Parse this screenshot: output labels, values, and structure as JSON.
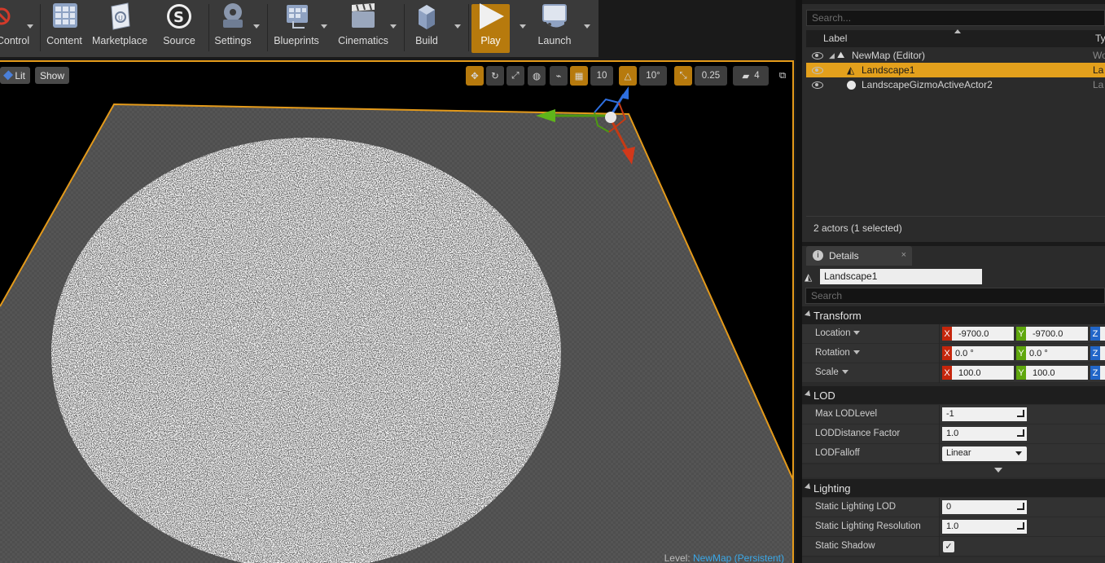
{
  "toolbar": {
    "items": [
      {
        "label": "Control",
        "icon": "source-control-icon"
      },
      {
        "label": "Content",
        "icon": "content-icon"
      },
      {
        "label": "Marketplace",
        "icon": "marketplace-icon"
      },
      {
        "label": "Source",
        "icon": "source-icon"
      },
      {
        "label": "Settings",
        "icon": "settings-icon"
      },
      {
        "label": "Blueprints",
        "icon": "blueprints-icon"
      },
      {
        "label": "Cinematics",
        "icon": "cinematics-icon"
      },
      {
        "label": "Build",
        "icon": "build-icon"
      },
      {
        "label": "Play",
        "icon": "play-icon"
      },
      {
        "label": "Launch",
        "icon": "launch-icon"
      }
    ]
  },
  "viewport": {
    "lit_label": "Lit",
    "show_label": "Show",
    "grid_snap": "10",
    "rotation_snap": "10°",
    "scale_snap": "0.25",
    "camera_speed": "4",
    "level_prefix": "Level:",
    "level_name": "NewMap (Persistent)"
  },
  "outliner": {
    "search_placeholder": "Search...",
    "col_label": "Label",
    "col_type": "Ty",
    "rows": [
      {
        "label": "NewMap (Editor)",
        "type": "Wo"
      },
      {
        "label": "Landscape1",
        "type": "La"
      },
      {
        "label": "LandscapeGizmoActiveActor2",
        "type": "La"
      }
    ],
    "status": "2 actors (1 selected)"
  },
  "details": {
    "tab_label": "Details",
    "actor_name": "Landscape1",
    "search_placeholder": "Search",
    "transform": {
      "title": "Transform",
      "location_label": "Location",
      "rotation_label": "Rotation",
      "scale_label": "Scale",
      "location": {
        "x": "-9700.0",
        "y": "-9700.0"
      },
      "rotation": {
        "x": "0.0 °",
        "y": "0.0 °"
      },
      "scale": {
        "x": "100.0",
        "y": "100.0"
      }
    },
    "lod": {
      "title": "LOD",
      "max_lod_label": "Max LODLevel",
      "max_lod_value": "-1",
      "lod_distance_label": "LODDistance Factor",
      "lod_distance_value": "1.0",
      "lod_falloff_label": "LODFalloff",
      "lod_falloff_value": "Linear"
    },
    "lighting": {
      "title": "Lighting",
      "static_lod_label": "Static Lighting LOD",
      "static_lod_value": "0",
      "static_res_label": "Static Lighting Resolution",
      "static_res_value": "1.0",
      "static_shadow_label": "Static Shadow",
      "static_shadow_checked": "✓"
    }
  },
  "colors": {
    "accent": "#e3a01c",
    "axis_x": "#c5260c",
    "axis_y": "#5fa70d",
    "axis_z": "#2266c8"
  }
}
